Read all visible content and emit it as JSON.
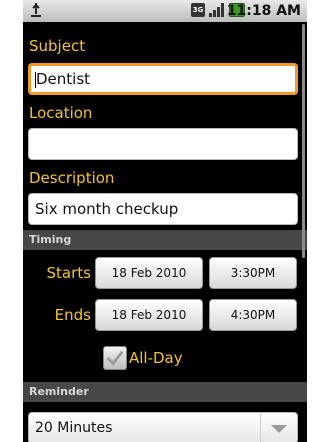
{
  "status_bar": {
    "time": "11:18 AM",
    "network": "3G"
  },
  "form": {
    "subject_label": "Subject",
    "subject_value": "Dentist",
    "location_label": "Location",
    "location_value": "",
    "description_label": "Description",
    "description_value": "Six month checkup"
  },
  "timing": {
    "header": "Timing",
    "starts_label": "Starts",
    "start_date": "18 Feb 2010",
    "start_time": "3:30PM",
    "ends_label": "Ends",
    "end_date": "18 Feb 2010",
    "end_time": "4:30PM",
    "all_day_label": "All-Day",
    "all_day_checked": true
  },
  "reminder": {
    "header": "Reminder",
    "value": "20 Minutes"
  },
  "colors": {
    "label": "#f7c22a",
    "focus": "#f39a26",
    "background": "#000000"
  }
}
